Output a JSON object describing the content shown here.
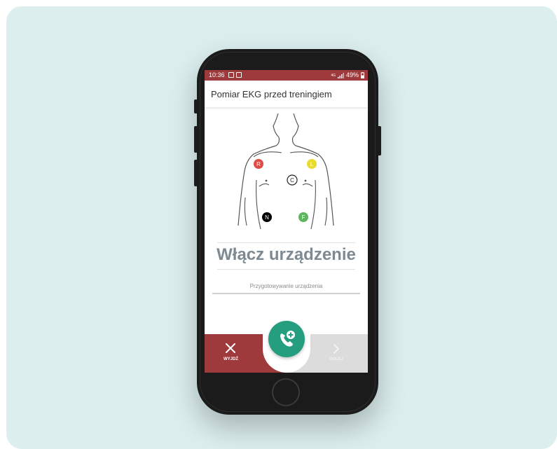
{
  "statusbar": {
    "time": "10:36",
    "net_small": "4G",
    "battery": "49%"
  },
  "screen": {
    "title": "Pomiar EKG przed treningiem"
  },
  "electrodes": [
    {
      "letter": "R",
      "color": "#e04a43"
    },
    {
      "letter": "L",
      "color": "#e9dc2d"
    },
    {
      "letter": "C",
      "color": "#ffffff"
    },
    {
      "letter": "N",
      "color": "#000000"
    },
    {
      "letter": "F",
      "color": "#5db55d"
    }
  ],
  "status": {
    "heading": "Włącz urządzenie",
    "subtext": "Przygotowywanie urządzenia"
  },
  "actions": {
    "exit_label": "WYJDŹ",
    "next_label": "DALEJ",
    "call_icon": "phone-plus-icon"
  },
  "colors": {
    "brand_red": "#9e3a3c",
    "brand_green": "#249e7e",
    "disabled_gray": "#dcdcdc"
  }
}
